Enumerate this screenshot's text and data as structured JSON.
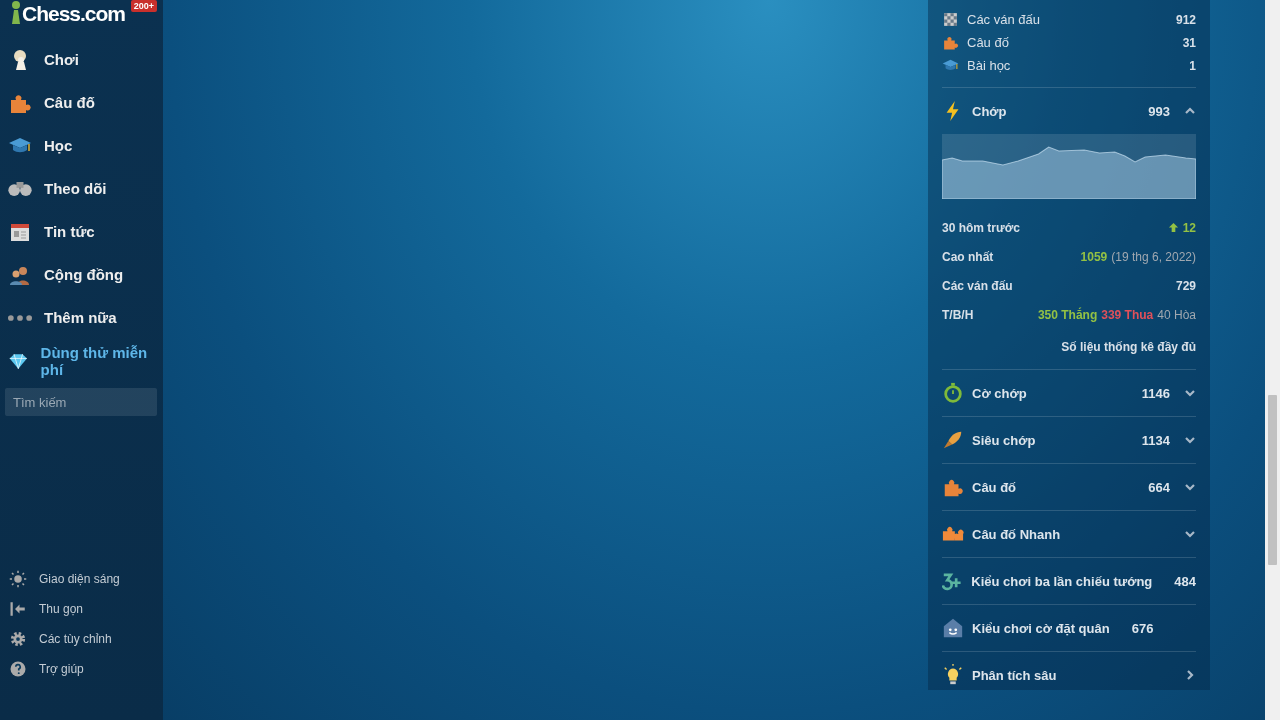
{
  "sidebar": {
    "logo": "Chess.com",
    "badge": "200+",
    "nav_items": [
      {
        "label": "Chơi",
        "kind": "nav"
      },
      {
        "label": "Câu đố",
        "kind": "nav"
      },
      {
        "label": "Học",
        "kind": "nav"
      },
      {
        "label": "Theo dõi",
        "kind": "nav"
      },
      {
        "label": "Tin tức",
        "kind": "nav"
      },
      {
        "label": "Cộng đồng",
        "kind": "nav"
      },
      {
        "label": "Thêm nữa",
        "kind": "nav"
      },
      {
        "label": "Dùng thử miễn phí",
        "kind": "promo"
      }
    ],
    "search": {
      "placeholder": "Tìm kiếm"
    },
    "footer_items": [
      {
        "label": "Giao diện sáng"
      },
      {
        "label": "Thu gọn"
      },
      {
        "label": "Các tùy chỉnh"
      },
      {
        "label": "Trợ giúp"
      }
    ]
  },
  "stats_panel": {
    "counts": [
      {
        "label": "Các ván đấu",
        "value": "912"
      },
      {
        "label": "Câu đố",
        "value": "31"
      },
      {
        "label": "Bài học",
        "value": "1"
      }
    ],
    "ratings": [
      {
        "label": "Chớp",
        "rating": "993",
        "kind": "expandable",
        "expanded": true,
        "details": {
          "trend_label": "30 hôm trước",
          "trend": "12",
          "best_label": "Cao nhất",
          "best": "1059",
          "best_date": "(19 thg 6, 2022)",
          "games_label": "Các ván đấu",
          "games": "729",
          "record_label": "T/B/H",
          "wins": "350 Thắng",
          "losses": "339 Thua",
          "draws": "40 Hòa",
          "full_stats_link": "Số liệu thống kê đầy đủ"
        }
      },
      {
        "label": "Cờ chớp",
        "rating": "1146",
        "kind": "expandable",
        "expanded": false
      },
      {
        "label": "Siêu chớp",
        "rating": "1134",
        "kind": "expandable",
        "expanded": false
      },
      {
        "label": "Câu đố",
        "rating": "664",
        "kind": "expandable",
        "expanded": false
      },
      {
        "label": "Câu đố Nhanh",
        "kind": "expandable",
        "expanded": false
      },
      {
        "label": "Kiểu chơi ba lần chiếu tướng",
        "rating": "484",
        "kind": "plain"
      },
      {
        "label": "Kiểu chơi cờ đặt quân",
        "rating": "676",
        "kind": "plain"
      },
      {
        "label": "Phân tích sâu",
        "kind": "link"
      }
    ]
  }
}
